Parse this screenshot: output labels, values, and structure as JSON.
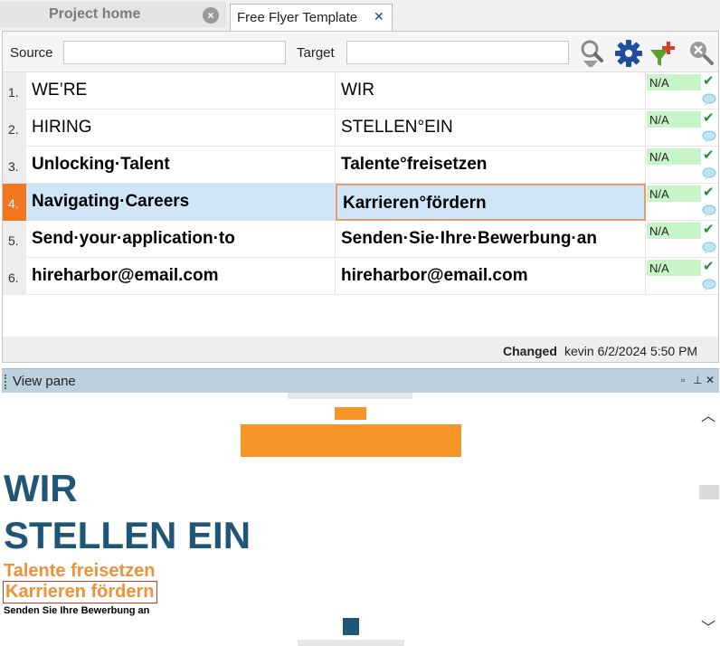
{
  "tabs": {
    "home_label": "Project home",
    "active_label": "Free Flyer Template"
  },
  "filter": {
    "source_label": "Source",
    "target_label": "Target",
    "source_value": "",
    "target_value": ""
  },
  "segments": [
    {
      "num": "1.",
      "source": "WE’RE",
      "target": "WIR",
      "status": "N/A"
    },
    {
      "num": "2.",
      "source": "HIRING",
      "target": "STELLEN°EIN",
      "status": "N/A"
    },
    {
      "num": "3.",
      "source": "Unlocking·Talent",
      "target": "Talente°freisetzen",
      "status": "N/A"
    },
    {
      "num": "4.",
      "source": "Navigating·Careers",
      "target": "Karrieren°fördern",
      "status": "N/A"
    },
    {
      "num": "5.",
      "source": "Send·your·application·to",
      "target": "Senden·Sie·Ihre·Bewerbung·an",
      "status": "N/A"
    },
    {
      "num": "6.",
      "source": "hireharbor@email.com",
      "target": "hireharbor@email.com",
      "status": "N/A"
    }
  ],
  "status_bar": {
    "label": "Changed",
    "value": "kevin 6/2/2024 5:50 PM"
  },
  "view_pane": {
    "title": "View pane",
    "heading1": "WIR",
    "heading2": "STELLEN EIN",
    "sub1": "Talente freisetzen",
    "sub2": "Karrieren fördern",
    "small": "Senden Sie Ihre Bewerbung an"
  },
  "colors": {
    "accent_orange": "#f59528",
    "heading_blue": "#1f5576",
    "selected_row": "#cfe6f8",
    "status_green": "#c8f5c8"
  }
}
